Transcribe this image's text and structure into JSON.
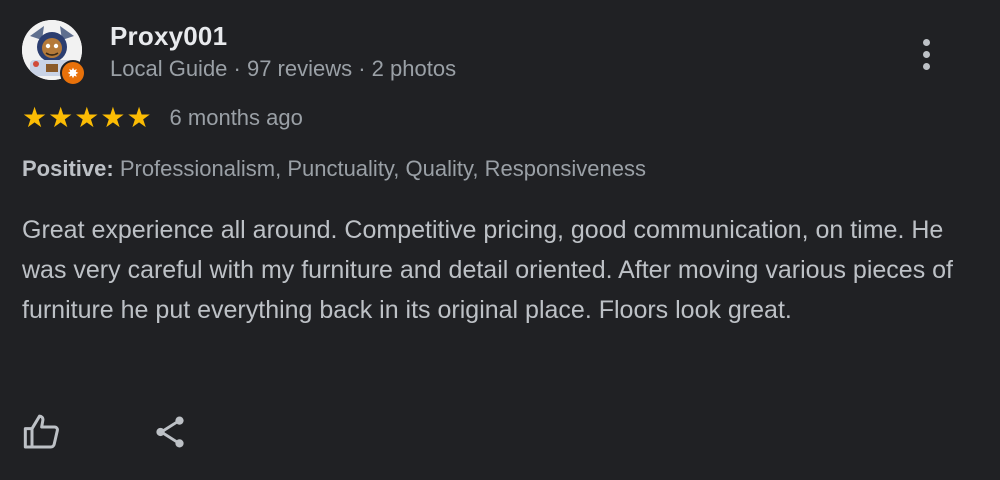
{
  "reviewer": {
    "name": "Proxy001",
    "meta": "Local Guide · 97 reviews · 2 photos",
    "badge_symbol": "✸"
  },
  "rating": {
    "stars": 5,
    "max_stars": 5,
    "star_glyph": "★",
    "date": "6 months ago"
  },
  "positive": {
    "label": "Positive:",
    "values": " Professionalism, Punctuality, Quality, Responsiveness"
  },
  "review_text": "Great experience all around. Competitive pricing, good communication, on time. He was very careful with my furniture and detail oriented. After moving various pieces of furniture he put everything back in its original place. Floors look great.",
  "colors": {
    "background": "#202124",
    "star": "#fbbc04",
    "badge": "#e8710a",
    "primary_text": "#e8eaed",
    "secondary_text": "#9aa0a6"
  },
  "icons": {
    "more": "more-vert-icon",
    "like": "thumb-up-icon",
    "share": "share-icon"
  }
}
